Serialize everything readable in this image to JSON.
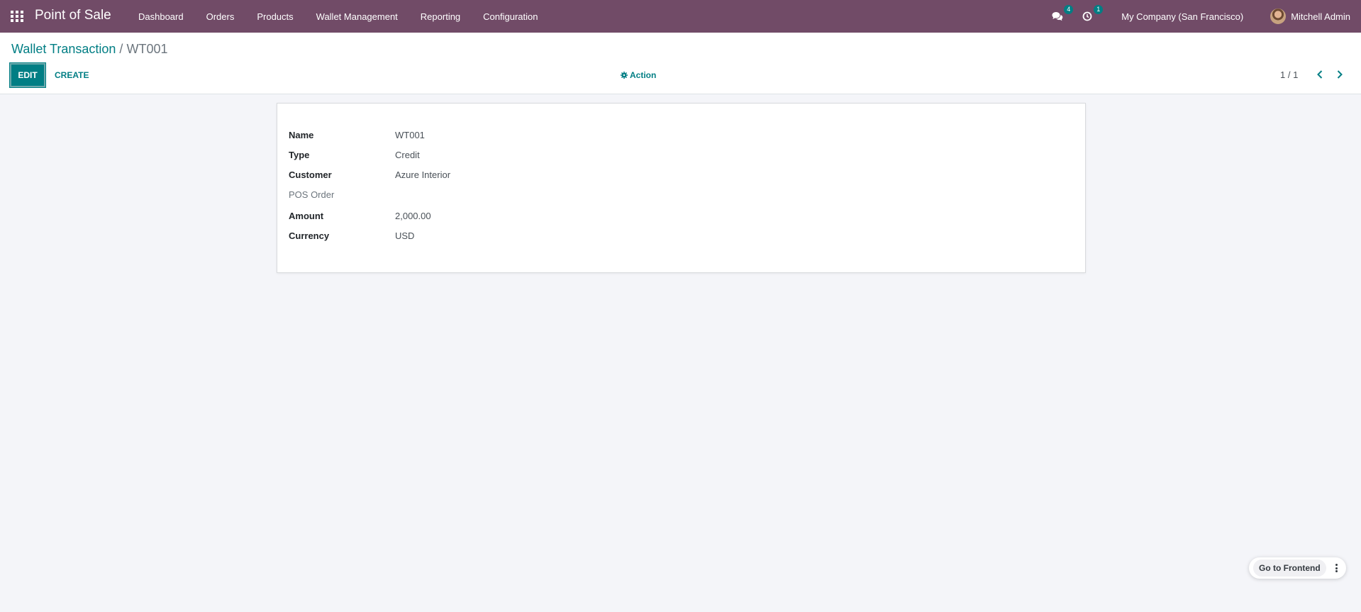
{
  "navbar": {
    "app_title": "Point of Sale",
    "menu": [
      "Dashboard",
      "Orders",
      "Products",
      "Wallet Management",
      "Reporting",
      "Configuration"
    ],
    "messages_count": "4",
    "activities_count": "1",
    "company": "My Company (San Francisco)",
    "user_name": "Mitchell Admin"
  },
  "breadcrumb": {
    "parent": "Wallet Transaction",
    "separator": "/",
    "current": "WT001"
  },
  "buttons": {
    "edit": "EDIT",
    "create": "CREATE",
    "action": "Action"
  },
  "pager": {
    "value": "1 / 1"
  },
  "form": {
    "fields": [
      {
        "label": "Name",
        "value": "WT001"
      },
      {
        "label": "Type",
        "value": "Credit"
      },
      {
        "label": "Customer",
        "value": "Azure Interior"
      },
      {
        "label": "POS Order",
        "value": ""
      },
      {
        "label": "Amount",
        "value": "2,000.00"
      },
      {
        "label": "Currency",
        "value": "USD"
      }
    ]
  },
  "floating": {
    "go_to_frontend": "Go to Frontend"
  },
  "colors": {
    "navbar": "#714b67",
    "accent": "#017e84",
    "background": "#f4f5f9"
  }
}
